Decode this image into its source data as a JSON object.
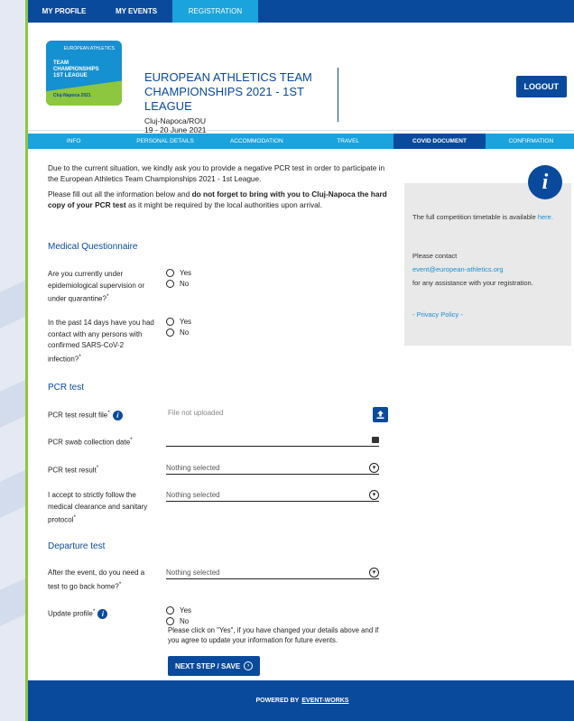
{
  "nav": {
    "items": [
      {
        "label": "MY PROFILE"
      },
      {
        "label": "MY EVENTS"
      },
      {
        "label": "REGISTRATION"
      }
    ]
  },
  "event": {
    "logo_lines": [
      "TEAM",
      "CHAMPIONSHIPS",
      "1ST LEAGUE"
    ],
    "logo_city": "Cluj-Napoca 2021",
    "logo_mark": "EUROPEAN ATHLETICS",
    "title": "EUROPEAN ATHLETICS TEAM CHAMPIONSHIPS 2021 - 1ST LEAGUE",
    "location": "Cluj-Napoca/ROU",
    "dates": "19 - 20 June 2021"
  },
  "header": {
    "logout_label": "LOGOUT"
  },
  "steps": [
    {
      "label": "INFO"
    },
    {
      "label": "PERSONAL DETAILS"
    },
    {
      "label": "ACCOMMODATION"
    },
    {
      "label": "TRAVEL"
    },
    {
      "label": "COVID DOCUMENT"
    },
    {
      "label": "CONFIRMATION"
    }
  ],
  "intro": {
    "p1": "Due to the current situation, we kindly ask you to provide a negative PCR test in order to participate in the European Athletics Team Championships 2021 - 1st League.",
    "p2_start": "Please fill out all the information below and ",
    "p2_bold": "do not forget to bring with you to Cluj-Napoca the hard copy of your PCR test",
    "p2_end": " as it might be required by the local authorities upon arrival."
  },
  "medical": {
    "title": "Medical Questionnaire",
    "q1": "Are you currently under epidemiological supervision or under quarantine?",
    "q2": "In the past 14 days have you had contact with any persons with confirmed SARS-CoV-2 infection?",
    "yes": "Yes",
    "no": "No"
  },
  "pcr": {
    "title": "PCR test",
    "file_label": "PCR test result file",
    "file_value": "File not uploaded",
    "date_label": "PCR swab collection date",
    "result_label": "PCR test result",
    "result_value": "Nothing selected",
    "protocol_label": "I accept to strictly follow the medical clearance and sanitary protocol",
    "protocol_value": "Nothing selected"
  },
  "departure": {
    "title": "Departure test",
    "question": "After the event, do you need a test to go back home?",
    "value": "Nothing selected",
    "update_label": "Update profile",
    "yes": "Yes",
    "no": "No",
    "update_help": "Please click on \"Yes\", if you have changed your details above and if you agree to update your information for future events.",
    "next_label": "NEXT STEP / SAVE"
  },
  "sidebar": {
    "timetable": "The full competition timetable is available",
    "timetable_link": "here.",
    "contact": "Please contact",
    "email": "event@european-athletics.org",
    "assist": "for any assistance with your registration.",
    "privacy": "- Privacy Policy -"
  },
  "footer": {
    "powered": "POWERED BY",
    "brand": "EVENT-WORKS"
  },
  "colors": {
    "primary": "#0a4a9c",
    "accent": "#1aa3dc",
    "green": "#8dc63f"
  }
}
